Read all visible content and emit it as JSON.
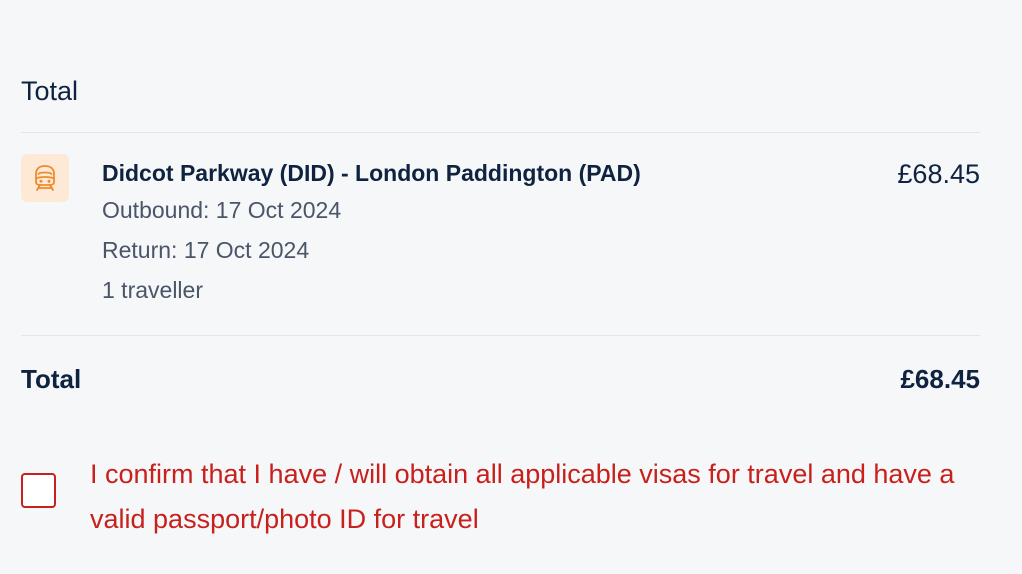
{
  "summary": {
    "title": "Total",
    "journey": {
      "icon": "train-icon",
      "route": "Didcot Parkway (DID) - London Paddington (PAD)",
      "outbound": "Outbound: 17 Oct 2024",
      "return": "Return: 17 Oct 2024",
      "travellers": "1 traveller",
      "price": "£68.45"
    },
    "total_label": "Total",
    "total_amount": "£68.45"
  },
  "confirm": {
    "text": "I confirm that I have / will obtain all applicable visas for travel and have a valid passport/photo ID for travel",
    "checked": false
  },
  "colors": {
    "text": "#0f2340",
    "muted": "#4a5568",
    "error": "#c8201c",
    "icon_bg": "#fde9d6",
    "icon_fg": "#f08a2c"
  }
}
